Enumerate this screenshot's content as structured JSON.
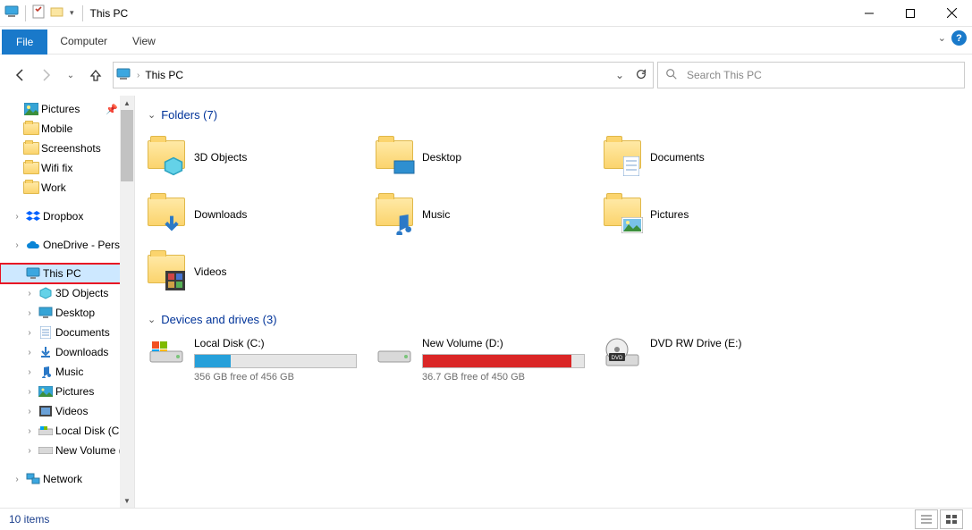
{
  "window": {
    "title": "This PC"
  },
  "ribbon": {
    "file": "File",
    "computer": "Computer",
    "view": "View"
  },
  "address": {
    "location": "This PC"
  },
  "search": {
    "placeholder": "Search This PC"
  },
  "sidebar": {
    "pictures": "Pictures",
    "mobile": "Mobile",
    "screenshots": "Screenshots",
    "wififix": "Wifi fix",
    "work": "Work",
    "dropbox": "Dropbox",
    "onedrive": "OneDrive - Person",
    "thispc": "This PC",
    "objects3d": "3D Objects",
    "desktop": "Desktop",
    "documents": "Documents",
    "downloads": "Downloads",
    "music": "Music",
    "sb_pictures": "Pictures",
    "videos": "Videos",
    "localdisk": "Local Disk (C:)",
    "newvolume": "New Volume (D:",
    "network": "Network"
  },
  "groups": {
    "folders_header": "Folders (7)",
    "drives_header": "Devices and drives (3)"
  },
  "folders": {
    "objects3d": "3D Objects",
    "desktop": "Desktop",
    "documents": "Documents",
    "downloads": "Downloads",
    "music": "Music",
    "pictures": "Pictures",
    "videos": "Videos"
  },
  "drives": {
    "c": {
      "name": "Local Disk (C:)",
      "free": "356 GB free of 456 GB",
      "fill_pct": 22,
      "color": "#26a0da"
    },
    "d": {
      "name": "New Volume (D:)",
      "free": "36.7 GB free of 450 GB",
      "fill_pct": 92,
      "color": "#da2626"
    },
    "dvd": {
      "name": "DVD RW Drive (E:)"
    }
  },
  "status": {
    "items": "10 items"
  }
}
